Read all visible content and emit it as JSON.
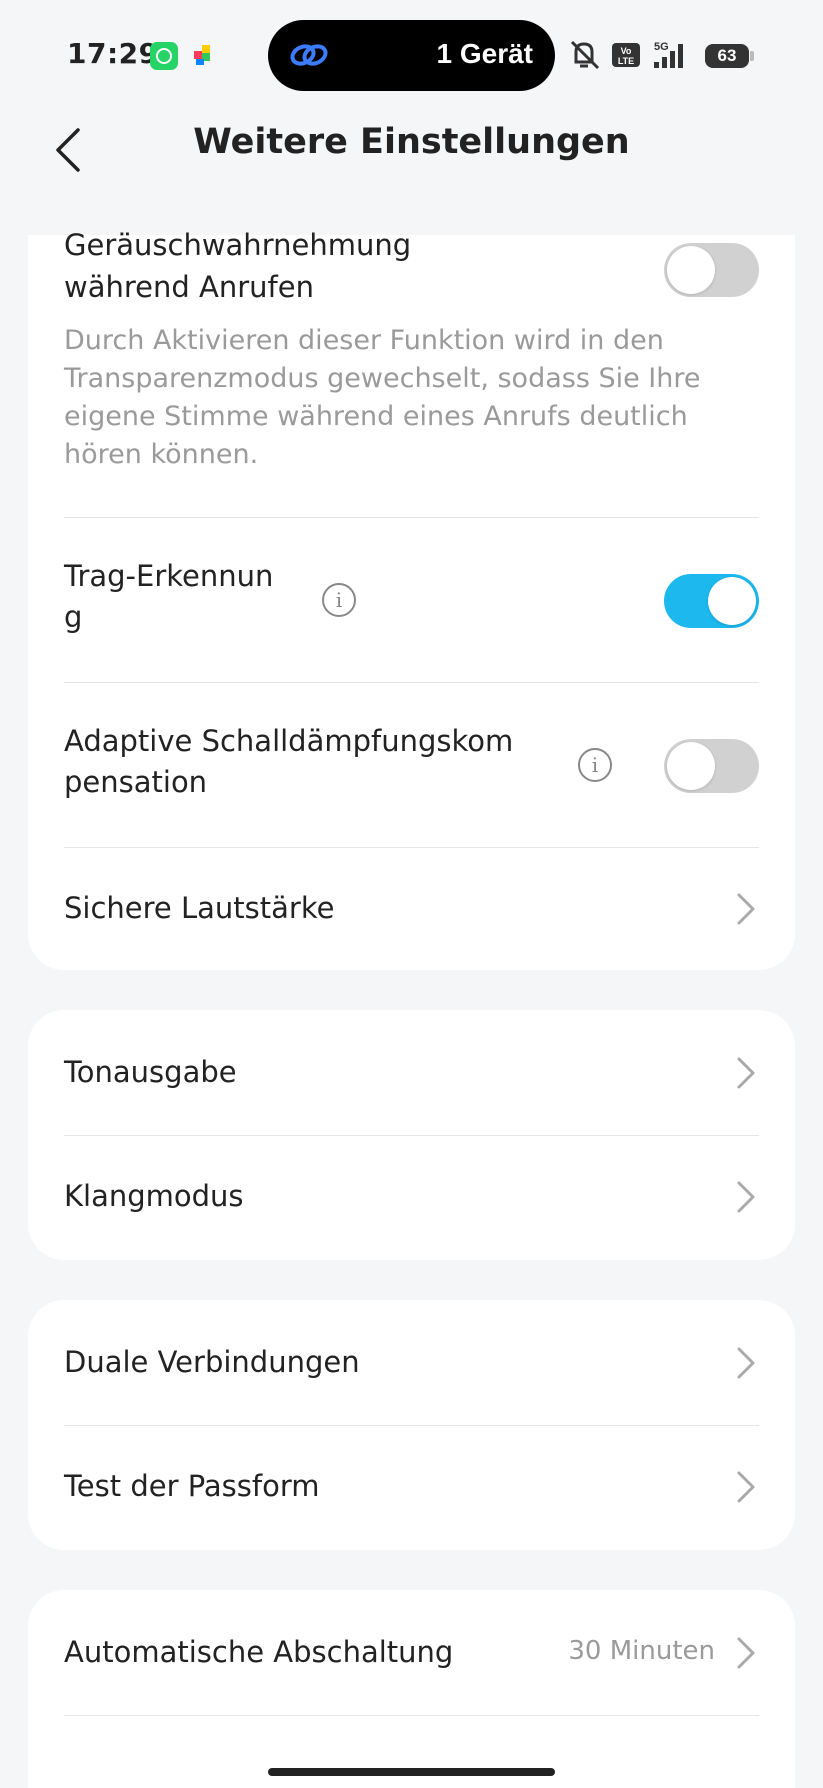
{
  "status_bar": {
    "time": "17:29",
    "island_text": "1 Gerät",
    "battery": "63",
    "icons": [
      "whatsapp-icon",
      "puzzle-app-icon",
      "link-icon",
      "mute-icon",
      "volte-icon",
      "5g-signal-icon",
      "battery-icon"
    ]
  },
  "header": {
    "title": "Weitere Einstellungen",
    "back_icon": "chevron-left-icon"
  },
  "settings": {
    "noise_awareness": {
      "label_line1": "Geräuschwahrnehmung",
      "label_line2": "während Anrufen",
      "description": [
        "Durch Aktivieren dieser Funktion wird in den",
        "Transparenzmodus gewechselt, sodass Sie Ihre",
        "eigene Stimme während eines Anrufs deutlich",
        "hören können."
      ],
      "enabled": false
    },
    "wear_detection": {
      "label_line1": "Trag-Erkennun",
      "label_line2": "g",
      "enabled": true
    },
    "adaptive_anc": {
      "label_line1": "Adaptive Schalldämpfungskom",
      "label_line2": "pensation",
      "enabled": false
    },
    "safe_volume": {
      "label": "Sichere Lautstärke"
    },
    "audio_output": {
      "label": "Tonausgabe"
    },
    "sound_mode": {
      "label": "Klangmodus"
    },
    "dual_connection": {
      "label": "Duale Verbindungen"
    },
    "fit_test": {
      "label": "Test der Passform"
    },
    "auto_off": {
      "label": "Automatische Abschaltung",
      "value": "30 Minuten"
    }
  },
  "colors": {
    "accent": "#1cb8ee",
    "background": "#f5f6f8",
    "card": "#ffffff",
    "toggle_off": "#d1d1d1"
  }
}
